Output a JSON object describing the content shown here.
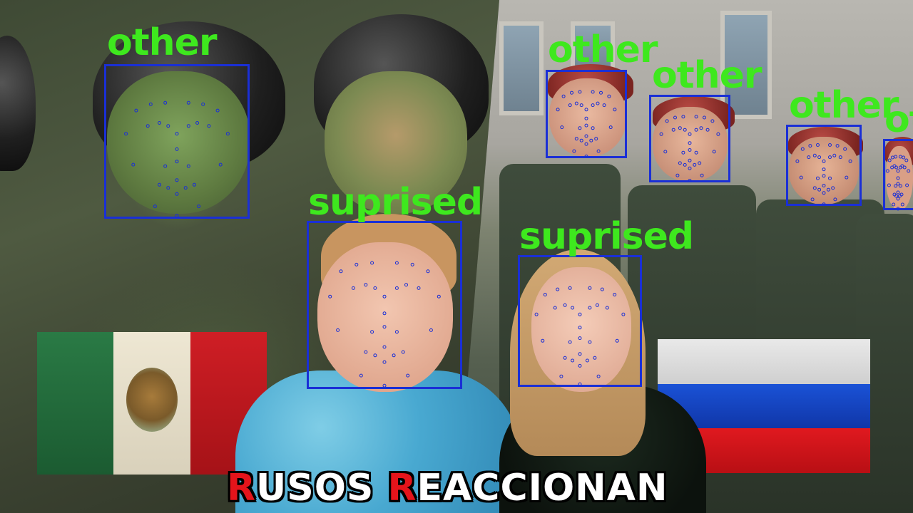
{
  "overlay_label_color": "#3ee81e",
  "box_color": "#1a2fd6",
  "detections": [
    {
      "label": "other"
    },
    {
      "label": "other"
    },
    {
      "label": "other"
    },
    {
      "label": "other"
    },
    {
      "label": "suprised"
    },
    {
      "label": "suprised"
    }
  ],
  "partial_labels": [
    "other",
    "other"
  ],
  "title": {
    "part1_initial": "R",
    "part1_rest": "USOS ",
    "part2_initial": "R",
    "part2_rest": "EACCIONAN",
    "accent_color": "#e4141b"
  },
  "flags": {
    "left": {
      "name": "mexico-flag",
      "colors": [
        "#1f6b3a",
        "#e9e2cf",
        "#c4161c"
      ]
    },
    "right": {
      "name": "russia-flag",
      "colors": [
        "#f2f2f2",
        "#1448c8",
        "#d5151d"
      ]
    }
  }
}
